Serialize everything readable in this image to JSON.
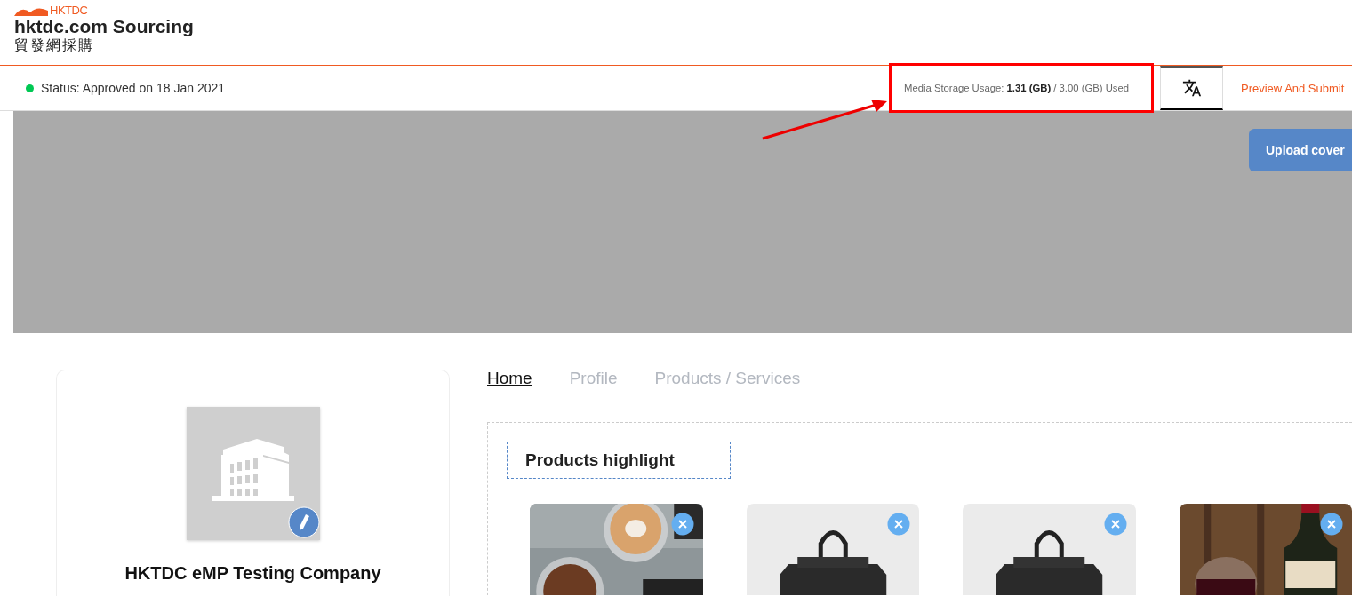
{
  "header": {
    "logo_text": "HKTDC",
    "site_name": "hktdc.com Sourcing",
    "site_name_chinese": "貿發網採購"
  },
  "status_bar": {
    "status": "Status: Approved on 18 Jan 2021",
    "storage": "Media Storage Usage: **1.31 (GB)** / 3.00 (GB) Used",
    "preview_link": "Preview And Submit"
  },
  "cover": {
    "upload_button": "Upload cover"
  },
  "company": {
    "name": "HKTDC eMP Testing Company"
  },
  "tabs": [
    {
      "label": "Home",
      "selected": true
    },
    {
      "label": "Profile",
      "selected": false
    },
    {
      "label": "Products / Services",
      "selected": false
    }
  ],
  "section": {
    "title": "Products highlight"
  },
  "products": [
    {
      "kind": "coffee"
    },
    {
      "kind": "bag"
    },
    {
      "kind": "bag"
    },
    {
      "kind": "wine"
    }
  ]
}
